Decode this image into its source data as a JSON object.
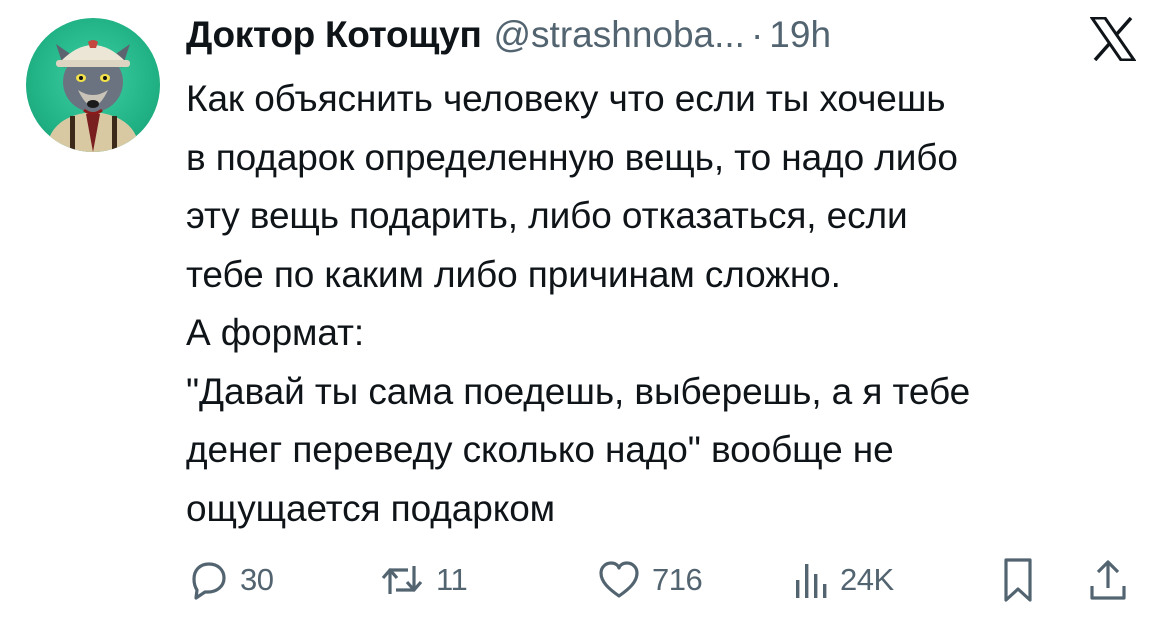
{
  "author": {
    "display_name": "Доктор Котощуп",
    "handle": "@strashnoba...",
    "separator": "·",
    "time": "19h",
    "avatar_icon": "wolf-avatar-icon"
  },
  "platform_logo": "x-logo-icon",
  "tweet": {
    "lines": [
      "Как объяснить человеку что если ты хочешь",
      "в подарок определенную вещь, то надо либо",
      "эту вещь подарить, либо отказаться, если",
      "тебе по каким либо причинам сложно.",
      "А формат:",
      "\"Давай ты сама поедешь, выберешь, а я тебе",
      "денег переведу сколько надо\" вообще не",
      "ощущается подарком"
    ]
  },
  "actions": {
    "reply": {
      "icon": "reply-icon",
      "count": "30"
    },
    "retweet": {
      "icon": "retweet-icon",
      "count": "11"
    },
    "like": {
      "icon": "heart-icon",
      "count": "716"
    },
    "views": {
      "icon": "views-icon",
      "count": "24K"
    },
    "bookmark": {
      "icon": "bookmark-icon"
    },
    "share": {
      "icon": "share-icon"
    }
  },
  "colors": {
    "text_primary": "#0f1419",
    "text_secondary": "#536471",
    "avatar_background": "#21b385"
  }
}
